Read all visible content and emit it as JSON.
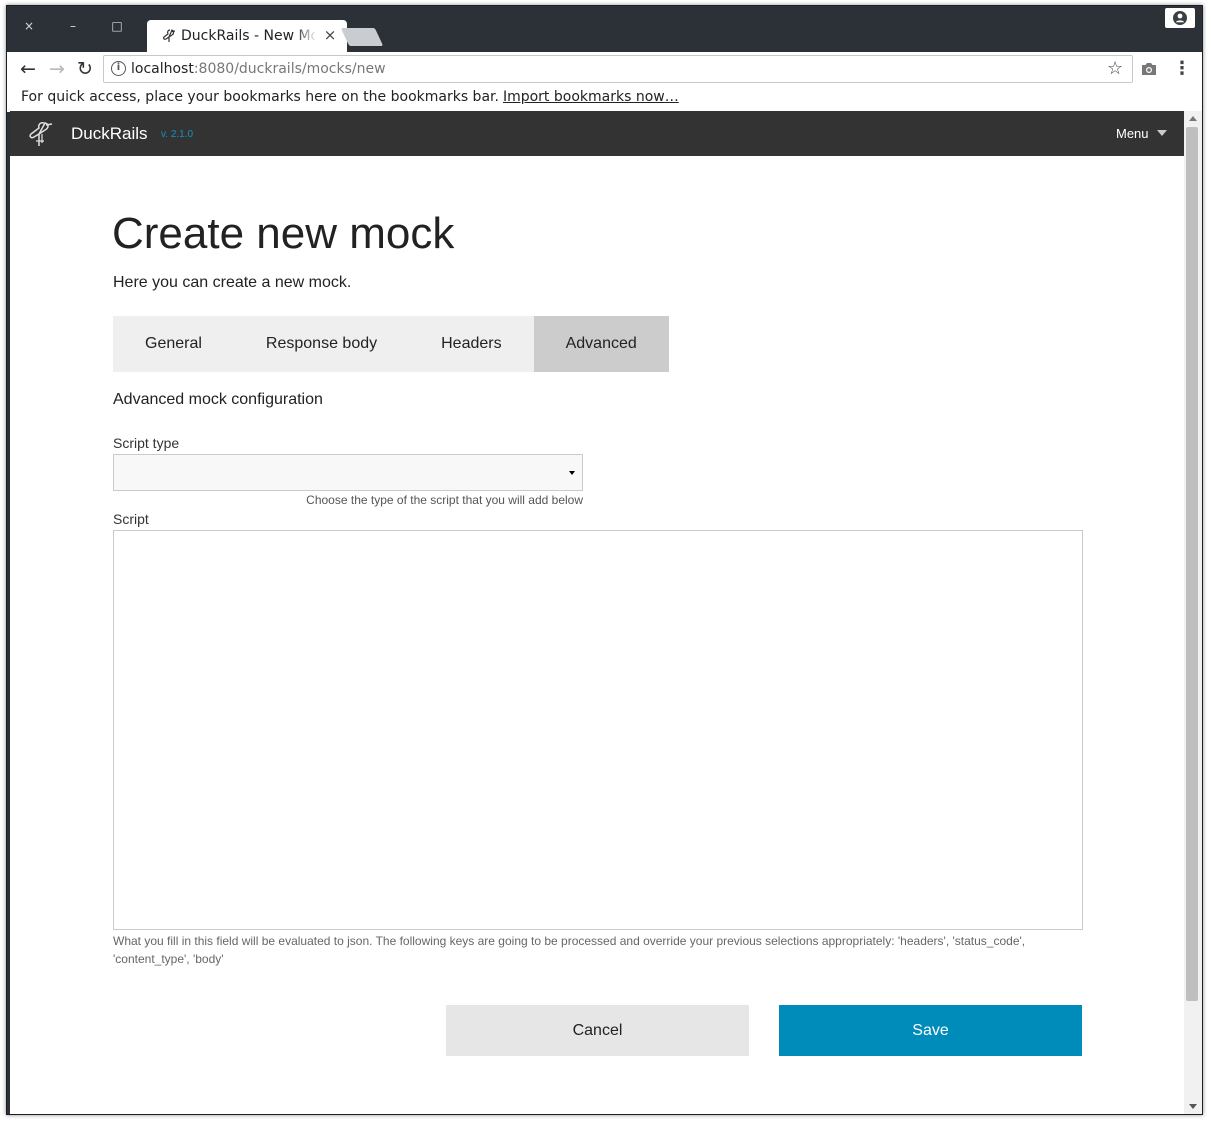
{
  "browser": {
    "tab_title": "DuckRails - New Mock",
    "url_host": "localhost",
    "url_path": ":8080/duckrails/mocks/new",
    "bookmarks_text": "For quick access, place your bookmarks here on the bookmarks bar.",
    "bookmarks_link": "Import bookmarks now…",
    "window_controls": {
      "close": "×",
      "minimize": "–",
      "maximize": "□"
    }
  },
  "navbar": {
    "brand": "DuckRails",
    "version": "v. 2.1.0",
    "menu_label": "Menu"
  },
  "page": {
    "title": "Create new mock",
    "subtitle": "Here you can create a new mock.",
    "tabs": [
      {
        "label": "General",
        "active": false
      },
      {
        "label": "Response body",
        "active": false
      },
      {
        "label": "Headers",
        "active": false
      },
      {
        "label": "Advanced",
        "active": true
      }
    ],
    "section_heading": "Advanced mock configuration"
  },
  "form": {
    "script_type_label": "Script type",
    "script_type_value": "",
    "script_type_help": "Choose the type of the script that you will add below",
    "script_label": "Script",
    "script_value": "",
    "script_help": "What you fill in this field will be evaluated to json. The following keys are going to be processed and override your previous selections appropriately: 'headers', 'status_code', 'content_type', 'body'"
  },
  "actions": {
    "cancel": "Cancel",
    "save": "Save"
  },
  "colors": {
    "navbar_bg": "#333333",
    "version_text": "#1a8fc4",
    "save_button": "#008cba",
    "cancel_button": "#e6e6e6",
    "active_tab": "#cccccc",
    "tab_bar": "#efefef"
  },
  "icons": {
    "tab_favicon": "duck-icon",
    "brand_logo": "duck-logo-icon",
    "info": "info-icon",
    "star": "star-icon",
    "camera": "camera-icon",
    "more": "more-vert-icon",
    "profile": "profile-icon"
  }
}
